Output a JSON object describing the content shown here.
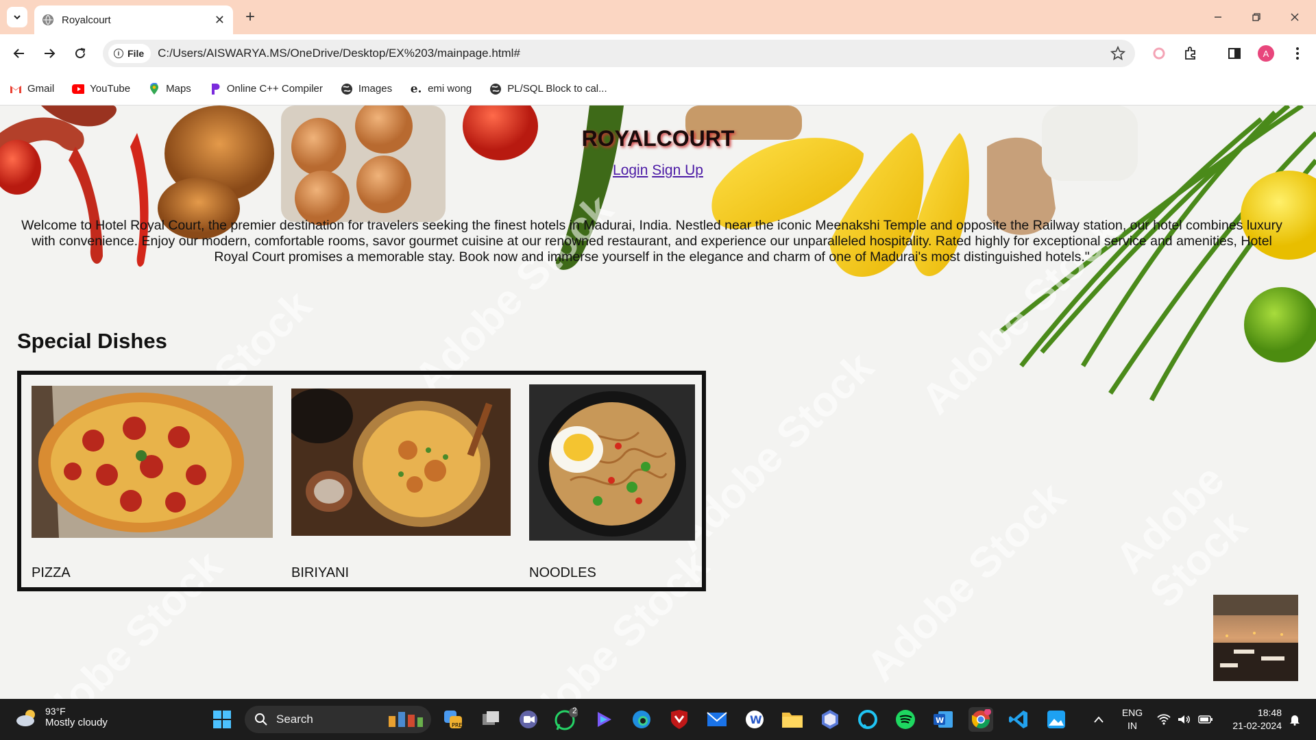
{
  "browser": {
    "tab_title": "Royalcourt",
    "address_chip": "File",
    "url": "C:/Users/AISWARYA.MS/OneDrive/Desktop/EX%203/mainpage.html#",
    "profile_initial": "A"
  },
  "bookmarks": [
    {
      "label": "Gmail",
      "icon": "gmail-icon"
    },
    {
      "label": "YouTube",
      "icon": "youtube-icon"
    },
    {
      "label": "Maps",
      "icon": "maps-icon"
    },
    {
      "label": "Online C++ Compiler",
      "icon": "compiler-icon"
    },
    {
      "label": "Images",
      "icon": "globe-icon"
    },
    {
      "label": "emi wong",
      "icon": "emi-icon"
    },
    {
      "label": "PL/SQL Block to cal...",
      "icon": "globe-icon"
    }
  ],
  "page": {
    "brand": "ROYALCOURT",
    "login_link": "Login",
    "signup_link": "Sign Up",
    "welcome": "Welcome to Hotel Royal Court, the premier destination for travelers seeking the finest hotels in Madurai, India. Nestled near the iconic Meenakshi Temple and opposite the Railway station, our hotel combines luxury with convenience. Enjoy our modern, comfortable rooms, savor gourmet cuisine at our renowned restaurant, and experience our unparalleled hospitality. Rated highly for exceptional service and amenities, Hotel Royal Court promises a memorable stay. Book now and immerse yourself in the elegance and charm of one of Madurai's most distinguished hotels.\"",
    "special_title": "Special Dishes",
    "dishes": [
      {
        "name": "PIZZA"
      },
      {
        "name": "BIRIYANI"
      },
      {
        "name": "NOODLES"
      }
    ],
    "watermark": "Adobe Stock"
  },
  "taskbar": {
    "temperature": "93°F",
    "weather": "Mostly cloudy",
    "search_label": "Search",
    "whatsapp_badge": "2",
    "lang_line1": "ENG",
    "lang_line2": "IN",
    "time": "18:48",
    "date": "21-02-2024"
  }
}
